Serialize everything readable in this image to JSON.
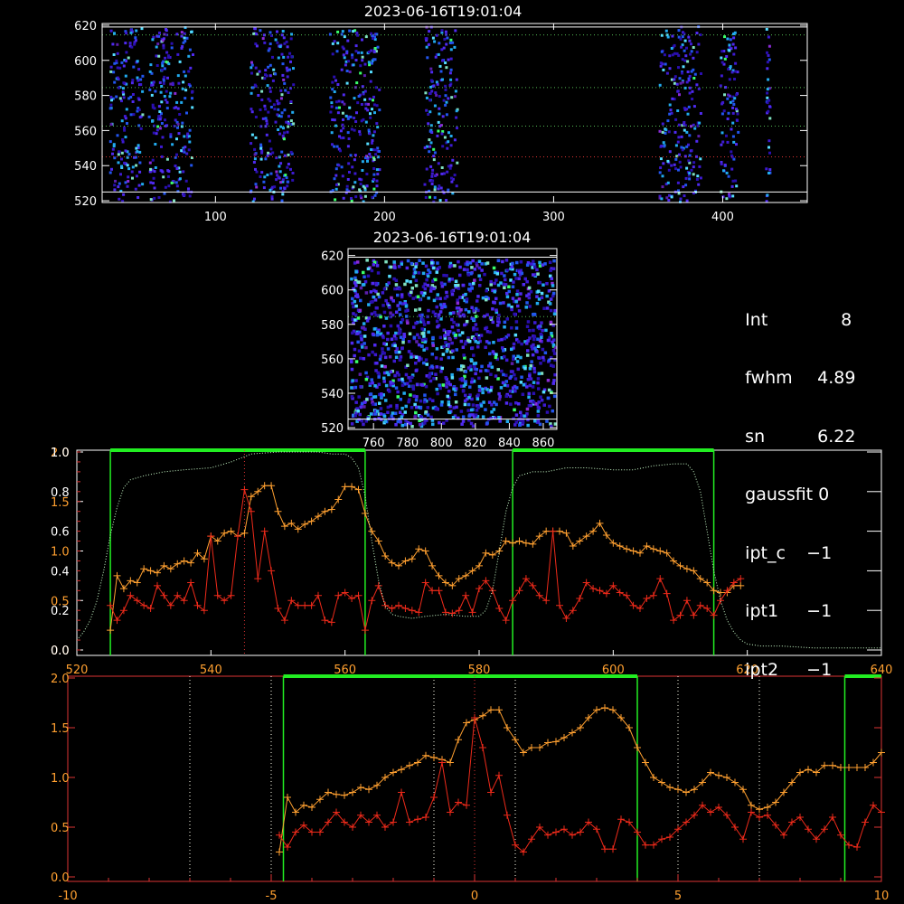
{
  "chart_data": [
    {
      "id": "raster-top",
      "type": "heatmap",
      "title": "2023-06-16T19:01:04",
      "xticks": [
        100,
        200,
        300,
        400
      ],
      "yticks": [
        520,
        540,
        560,
        580,
        600,
        620
      ],
      "xlim": [
        33,
        450
      ],
      "ylim": [
        519,
        621
      ],
      "bands": [
        [
          37,
          58
        ],
        [
          60,
          88
        ],
        [
          120,
          147
        ],
        [
          167,
          198
        ],
        [
          223,
          244
        ],
        [
          362,
          388
        ],
        [
          398,
          410
        ],
        [
          425,
          429
        ]
      ],
      "hlines": [
        {
          "y": 619,
          "color": "#ffffff",
          "style": "solid"
        },
        {
          "y": 525,
          "color": "#ffffff",
          "style": "solid"
        },
        {
          "y": 614.5,
          "color": "#55bb55",
          "style": "dotted"
        },
        {
          "y": 584.5,
          "color": "#55bb55",
          "style": "dotted"
        },
        {
          "y": 562.5,
          "color": "#55bb55",
          "style": "dotted"
        },
        {
          "y": 545,
          "color": "#dd3333",
          "style": "dotted"
        }
      ]
    },
    {
      "id": "raster-zoom",
      "type": "heatmap",
      "title": "2023-06-16T19:01:04",
      "xticks": [
        760,
        780,
        800,
        820,
        840,
        860
      ],
      "yticks": [
        520,
        540,
        560,
        580,
        600,
        620
      ],
      "xlim": [
        745,
        868
      ],
      "ylim": [
        519,
        624
      ],
      "hlines": [
        {
          "y": 619,
          "color": "#ffffff",
          "style": "solid"
        },
        {
          "y": 525,
          "color": "#ffffff",
          "style": "solid"
        },
        {
          "y": 584.5,
          "color": "#55bb55",
          "style": "dotted"
        }
      ]
    },
    {
      "id": "profile-position",
      "type": "line",
      "xlim": [
        520,
        640
      ],
      "xticks": [
        520,
        540,
        560,
        580,
        600,
        620,
        640
      ],
      "yticks_left_outer": [
        "0.0",
        "0.5",
        "1.0",
        "1.5",
        "2.0"
      ],
      "yticks_left_outer_values": [
        0,
        0.5,
        1.0,
        1.5,
        2.0
      ],
      "yticks_left_inner": [
        "0.0",
        "0.2",
        "0.4",
        "0.6",
        "0.8",
        "1.0"
      ],
      "yticks_left_inner_values": [
        0,
        0.2,
        0.4,
        0.6,
        0.8,
        1.0
      ],
      "ylim_outer": [
        0,
        2.0
      ],
      "ylim_inner": [
        0,
        1.0
      ],
      "vlines_green": [
        525,
        563,
        585,
        615
      ],
      "green_bars": [
        [
          525,
          563
        ],
        [
          585,
          615
        ]
      ],
      "vline_red": 545,
      "series": [
        {
          "color": "#ffa030",
          "axis": "outer",
          "x": [
            525,
            526,
            527,
            528,
            529,
            530,
            531,
            532,
            533,
            534,
            535,
            536,
            537,
            538,
            539,
            540,
            541,
            542,
            543,
            544,
            545,
            546,
            547,
            548,
            549,
            550,
            551,
            552,
            553,
            554,
            555,
            556,
            557,
            558,
            559,
            560,
            561,
            562,
            563,
            564,
            565,
            566,
            567,
            568,
            569,
            570,
            571,
            572,
            573,
            574,
            575,
            576,
            577,
            578,
            579,
            580,
            581,
            582,
            583,
            584,
            585,
            586,
            587,
            588,
            589,
            590,
            591,
            592,
            593,
            594,
            595,
            596,
            597,
            598,
            599,
            600,
            601,
            602,
            603,
            604,
            605,
            606,
            607,
            608,
            609,
            610,
            611,
            612,
            613,
            614,
            615,
            616,
            617,
            618,
            619
          ],
          "values": [
            0.2,
            0.75,
            0.62,
            0.7,
            0.68,
            0.82,
            0.8,
            0.78,
            0.85,
            0.82,
            0.87,
            0.9,
            0.88,
            0.98,
            0.92,
            1.15,
            1.1,
            1.18,
            1.2,
            1.15,
            1.18,
            1.55,
            1.6,
            1.66,
            1.66,
            1.4,
            1.25,
            1.28,
            1.22,
            1.27,
            1.3,
            1.35,
            1.4,
            1.42,
            1.52,
            1.65,
            1.65,
            1.62,
            1.38,
            1.2,
            1.1,
            0.95,
            0.88,
            0.85,
            0.9,
            0.92,
            1.02,
            1.0,
            0.85,
            0.75,
            0.68,
            0.65,
            0.72,
            0.75,
            0.8,
            0.85,
            0.98,
            0.96,
            1.0,
            1.1,
            1.08,
            1.1,
            1.08,
            1.07,
            1.15,
            1.2,
            1.2,
            1.2,
            1.18,
            1.05,
            1.1,
            1.15,
            1.2,
            1.28,
            1.16,
            1.08,
            1.05,
            1.02,
            1.0,
            0.98,
            1.05,
            1.02,
            1.0,
            0.98,
            0.9,
            0.85,
            0.82,
            0.8,
            0.72,
            0.68,
            0.6,
            0.58,
            0.58,
            0.65,
            0.65
          ]
        },
        {
          "color": "#ee2a1a",
          "axis": "outer",
          "x": [
            525,
            526,
            527,
            528,
            529,
            530,
            531,
            532,
            533,
            534,
            535,
            536,
            537,
            538,
            539,
            540,
            541,
            542,
            543,
            544,
            545,
            546,
            547,
            548,
            549,
            550,
            551,
            552,
            553,
            554,
            555,
            556,
            557,
            558,
            559,
            560,
            561,
            562,
            563,
            564,
            565,
            566,
            567,
            568,
            569,
            570,
            571,
            572,
            573,
            574,
            575,
            576,
            577,
            578,
            579,
            580,
            581,
            582,
            583,
            584,
            585,
            586,
            587,
            588,
            589,
            590,
            591,
            592,
            593,
            594,
            595,
            596,
            597,
            598,
            599,
            600,
            601,
            602,
            603,
            604,
            605,
            606,
            607,
            608,
            609,
            610,
            611,
            612,
            613,
            614,
            615,
            616,
            617,
            618,
            619
          ],
          "values": [
            0.45,
            0.3,
            0.4,
            0.55,
            0.5,
            0.45,
            0.42,
            0.65,
            0.55,
            0.45,
            0.55,
            0.5,
            0.68,
            0.45,
            0.4,
            1.15,
            0.55,
            0.5,
            0.55,
            1.15,
            1.62,
            1.4,
            0.72,
            1.2,
            0.8,
            0.42,
            0.3,
            0.5,
            0.45,
            0.45,
            0.45,
            0.55,
            0.3,
            0.28,
            0.55,
            0.58,
            0.52,
            0.55,
            0.2,
            0.5,
            0.65,
            0.45,
            0.42,
            0.45,
            0.42,
            0.4,
            0.38,
            0.68,
            0.6,
            0.6,
            0.38,
            0.37,
            0.4,
            0.55,
            0.38,
            0.62,
            0.7,
            0.6,
            0.42,
            0.3,
            0.5,
            0.6,
            0.72,
            0.65,
            0.55,
            0.5,
            1.2,
            0.45,
            0.32,
            0.4,
            0.52,
            0.68,
            0.62,
            0.6,
            0.57,
            0.65,
            0.58,
            0.55,
            0.45,
            0.42,
            0.52,
            0.55,
            0.72,
            0.57,
            0.3,
            0.35,
            0.5,
            0.35,
            0.45,
            0.42,
            0.35,
            0.5,
            0.6,
            0.68,
            0.72
          ]
        },
        {
          "color": "#ccffcc",
          "axis": "inner",
          "style": "dotted",
          "x": [
            520,
            521,
            522,
            523,
            524,
            525,
            526,
            527,
            528,
            530,
            533,
            536,
            540,
            543,
            546,
            550,
            553,
            556,
            558,
            560,
            561,
            562,
            563,
            564,
            565,
            566,
            567,
            568,
            570,
            572,
            575,
            578,
            580,
            581,
            582,
            583,
            584,
            585,
            586,
            588,
            590,
            593,
            596,
            600,
            603,
            606,
            609,
            611,
            612,
            613,
            614,
            615,
            616,
            617,
            618,
            619,
            620,
            622,
            625,
            630,
            635,
            640
          ],
          "values": [
            0.05,
            0.09,
            0.15,
            0.25,
            0.4,
            0.58,
            0.72,
            0.82,
            0.86,
            0.88,
            0.9,
            0.91,
            0.92,
            0.95,
            0.99,
            1.0,
            1.0,
            1.0,
            0.99,
            0.99,
            0.97,
            0.92,
            0.78,
            0.55,
            0.35,
            0.22,
            0.18,
            0.17,
            0.16,
            0.17,
            0.18,
            0.17,
            0.17,
            0.2,
            0.3,
            0.5,
            0.7,
            0.82,
            0.88,
            0.9,
            0.9,
            0.92,
            0.92,
            0.91,
            0.91,
            0.93,
            0.94,
            0.94,
            0.9,
            0.8,
            0.6,
            0.4,
            0.25,
            0.15,
            0.09,
            0.05,
            0.03,
            0.02,
            0.02,
            0.01,
            0.01,
            0.01
          ]
        }
      ]
    },
    {
      "id": "profile-offset",
      "type": "line",
      "xlim": [
        -10,
        10
      ],
      "xticks": [
        -10,
        -5,
        0,
        5,
        10
      ],
      "yticks": [
        "0.0",
        "0.5",
        "1.0",
        "1.5",
        "2.0"
      ],
      "ytick_values": [
        0,
        0.5,
        1.0,
        1.5,
        2.0
      ],
      "ylim": [
        0,
        2.0
      ],
      "vlines_green": [
        -4.7,
        4.0,
        9.1
      ],
      "green_bars": [
        [
          -4.7,
          4.0
        ],
        [
          9.1,
          10.0
        ]
      ],
      "vlines_white_dotted": [
        -7,
        -5,
        -1,
        1,
        5,
        7
      ],
      "vline_red": 0,
      "series": [
        {
          "color": "#ffa030",
          "axis": "left",
          "x": [
            -4.8,
            -4.6,
            -4.4,
            -4.2,
            -4.0,
            -3.8,
            -3.6,
            -3.4,
            -3.2,
            -3.0,
            -2.8,
            -2.6,
            -2.4,
            -2.2,
            -2.0,
            -1.8,
            -1.6,
            -1.4,
            -1.2,
            -1.0,
            -0.8,
            -0.6,
            -0.4,
            -0.2,
            0.0,
            0.2,
            0.4,
            0.6,
            0.8,
            1.0,
            1.2,
            1.4,
            1.6,
            1.8,
            2.0,
            2.2,
            2.4,
            2.6,
            2.8,
            3.0,
            3.2,
            3.4,
            3.6,
            3.8,
            4.0,
            4.2,
            4.4,
            4.6,
            4.8,
            5.0,
            5.2,
            5.4,
            5.6,
            5.8,
            6.0,
            6.2,
            6.4,
            6.6,
            6.8,
            7.0,
            7.2,
            7.4,
            7.6,
            7.8,
            8.0,
            8.2,
            8.4,
            8.6,
            8.8,
            9.0,
            9.2,
            9.4,
            9.6,
            9.8,
            10.0
          ],
          "values": [
            0.25,
            0.8,
            0.65,
            0.72,
            0.7,
            0.78,
            0.85,
            0.83,
            0.82,
            0.85,
            0.9,
            0.88,
            0.92,
            1.0,
            1.05,
            1.08,
            1.12,
            1.15,
            1.22,
            1.2,
            1.18,
            1.15,
            1.38,
            1.55,
            1.58,
            1.62,
            1.68,
            1.68,
            1.5,
            1.38,
            1.25,
            1.3,
            1.3,
            1.35,
            1.36,
            1.4,
            1.45,
            1.5,
            1.6,
            1.68,
            1.7,
            1.68,
            1.6,
            1.5,
            1.3,
            1.15,
            1.0,
            0.95,
            0.9,
            0.88,
            0.85,
            0.88,
            0.95,
            1.05,
            1.02,
            1.0,
            0.95,
            0.88,
            0.72,
            0.68,
            0.7,
            0.75,
            0.85,
            0.95,
            1.05,
            1.08,
            1.05,
            1.12,
            1.12,
            1.1,
            1.1,
            1.1,
            1.1,
            1.15,
            1.25
          ]
        },
        {
          "color": "#ee2a1a",
          "axis": "left",
          "x": [
            -4.8,
            -4.6,
            -4.4,
            -4.2,
            -4.0,
            -3.8,
            -3.6,
            -3.4,
            -3.2,
            -3.0,
            -2.8,
            -2.6,
            -2.4,
            -2.2,
            -2.0,
            -1.8,
            -1.6,
            -1.4,
            -1.2,
            -1.0,
            -0.8,
            -0.6,
            -0.4,
            -0.2,
            0.0,
            0.2,
            0.4,
            0.6,
            0.8,
            1.0,
            1.2,
            1.4,
            1.6,
            1.8,
            2.0,
            2.2,
            2.4,
            2.6,
            2.8,
            3.0,
            3.2,
            3.4,
            3.6,
            3.8,
            4.0,
            4.2,
            4.4,
            4.6,
            4.8,
            5.0,
            5.2,
            5.4,
            5.6,
            5.8,
            6.0,
            6.2,
            6.4,
            6.6,
            6.8,
            7.0,
            7.2,
            7.4,
            7.6,
            7.8,
            8.0,
            8.2,
            8.4,
            8.6,
            8.8,
            9.0,
            9.2,
            9.4,
            9.6,
            9.8,
            10.0
          ],
          "values": [
            0.42,
            0.3,
            0.45,
            0.52,
            0.45,
            0.45,
            0.55,
            0.65,
            0.55,
            0.5,
            0.62,
            0.55,
            0.62,
            0.5,
            0.55,
            0.85,
            0.55,
            0.58,
            0.6,
            0.8,
            1.15,
            0.65,
            0.75,
            0.72,
            1.6,
            1.3,
            0.85,
            1.02,
            0.62,
            0.32,
            0.25,
            0.38,
            0.5,
            0.42,
            0.45,
            0.48,
            0.42,
            0.45,
            0.55,
            0.48,
            0.28,
            0.28,
            0.58,
            0.55,
            0.45,
            0.32,
            0.32,
            0.38,
            0.4,
            0.48,
            0.55,
            0.62,
            0.72,
            0.65,
            0.7,
            0.62,
            0.5,
            0.38,
            0.65,
            0.6,
            0.62,
            0.52,
            0.42,
            0.55,
            0.6,
            0.48,
            0.38,
            0.48,
            0.6,
            0.42,
            0.32,
            0.3,
            0.55,
            0.72,
            0.65
          ]
        }
      ]
    }
  ],
  "info_panel": [
    {
      "key": "Int",
      "value": "8",
      "pad": 38
    },
    {
      "key": "fwhm",
      "value": "4.89",
      "pad": 12
    },
    {
      "key": "sn",
      "value": "6.22",
      "pad": 12
    },
    {
      "key": "gaussfit",
      "value": "0",
      "pad": 2
    },
    {
      "key": "ipt_c",
      "value": "−1",
      "pad": 2
    },
    {
      "key": "ipt1",
      "value": "−1",
      "pad": 2
    },
    {
      "key": "ipt2",
      "value": "−1",
      "pad": 2
    }
  ]
}
